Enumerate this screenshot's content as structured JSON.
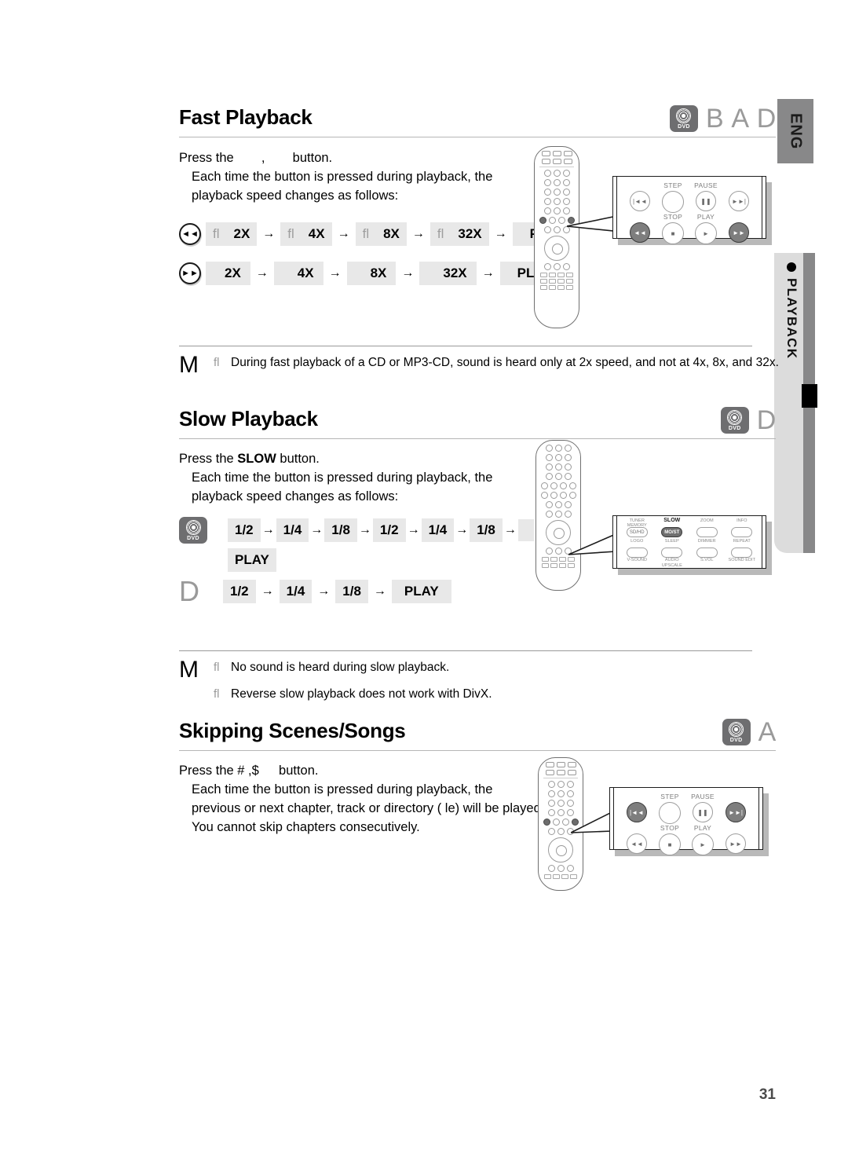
{
  "page": {
    "number": "31",
    "language_tab": "ENG"
  },
  "sidebar": {
    "section_label": "PLAYBACK",
    "bullet": "•"
  },
  "sections": [
    {
      "id": "fast-playback",
      "title": "Fast Playback",
      "disc_icons": [
        "DVD",
        "B",
        "A",
        "D"
      ],
      "intro": "Press the",
      "intro_buttons": ",",
      "intro_tail": "button.",
      "description_line1": "Each time the button is pressed during playback, the",
      "description_line2": "playback speed changes as follows:",
      "sequences": [
        {
          "button_icon": "◄◄",
          "steps": [
            "2X",
            "4X",
            "8X",
            "32X",
            "PLAY"
          ],
          "prefixes": [
            "fl",
            "fl",
            "fl",
            "fl",
            ""
          ],
          "arrow": "→"
        },
        {
          "button_icon": "►►",
          "steps": [
            "2X",
            "4X",
            "8X",
            "32X",
            "PLAY"
          ],
          "prefixes": [
            "",
            "",
            "",
            "",
            ""
          ],
          "arrow": "→"
        }
      ],
      "note": {
        "marker": "M",
        "bullets": [
          {
            "glyph": "fl",
            "text": "During fast playback of a CD or MP3-CD, sound is heard only at 2x speed, and not at 4x, 8x, and 32x."
          }
        ]
      }
    },
    {
      "id": "slow-playback",
      "title": "Slow Playback",
      "disc_icons": [
        "DVD",
        "D"
      ],
      "intro": "Press the",
      "intro_buttons": "SLOW",
      "intro_tail": "button.",
      "description_line1": "Each time the button is pressed during playback, the",
      "description_line2": "playback speed changes as follows:",
      "sequences": [
        {
          "button_icon": "DVD",
          "steps": [
            "1/2",
            "1/4",
            "1/8",
            "1/2",
            "1/4",
            "1/8",
            "",
            "PLAY"
          ],
          "arrow": "→"
        },
        {
          "button_icon": "D",
          "steps": [
            "1/2",
            "1/4",
            "1/8",
            "PLAY"
          ],
          "arrow": "→"
        }
      ],
      "note": {
        "marker": "M",
        "bullets": [
          {
            "glyph": "fl",
            "text": "No sound is heard during slow playback."
          },
          {
            "glyph": "fl",
            "text": "Reverse slow playback does not work with DivX."
          }
        ]
      }
    },
    {
      "id": "skipping-scenes",
      "title": "Skipping Scenes/Songs",
      "disc_icons": [
        "DVD",
        "A"
      ],
      "intro": "Press the",
      "intro_buttons": "# ,$",
      "intro_tail": "button.",
      "description_line1": "Each time the button is pressed during playback, the",
      "description_line2": "previous or next chapter, track or directory ( le) will be played.",
      "description_line3": "You cannot skip chapters consecutively."
    }
  ],
  "callouts": {
    "transport_top": {
      "labels": [
        "STEP",
        "PAUSE",
        "STOP",
        "PLAY"
      ],
      "buttons_row1": [
        "|◄◄",
        "",
        "❚❚",
        "►►|"
      ],
      "buttons_row2": [
        "◄◄",
        "■",
        "►",
        "►►"
      ],
      "highlighted": [
        "◄◄",
        "►►"
      ]
    },
    "transport_bottom": {
      "labels": [
        "STEP",
        "PAUSE",
        "STOP",
        "PLAY"
      ],
      "buttons_row1": [
        "|◄◄",
        "",
        "❚❚",
        "►►|"
      ],
      "buttons_row2": [
        "◄◄",
        "■",
        "►",
        "►►"
      ],
      "highlighted": [
        "|◄◄",
        "►►|"
      ]
    },
    "function_pad": {
      "rows": [
        {
          "top_labels": [
            "TUNER\nMEMORY",
            "SLOW",
            "ZOOM",
            "INFO"
          ],
          "buttons": [
            "SD/HD",
            "MO/ST",
            "",
            ""
          ],
          "highlighted": "MO/ST"
        },
        {
          "top_labels": [
            "LOGO",
            "SLEEP",
            "DIMMER",
            "REPEAT"
          ],
          "buttons": [
            "",
            "",
            "",
            ""
          ],
          "bottom_labels": [
            "V-SOUND",
            "AUDIO\nUPSCALE",
            "S.VOL",
            "SOUND EDIT"
          ]
        }
      ]
    }
  },
  "colors": {
    "tab_gray": "#888889",
    "tab_light": "#dcdcdc",
    "chip_bg": "#e8e8e8",
    "icon_gray": "#6e6e70",
    "letter_gray": "#9a9a9a"
  }
}
